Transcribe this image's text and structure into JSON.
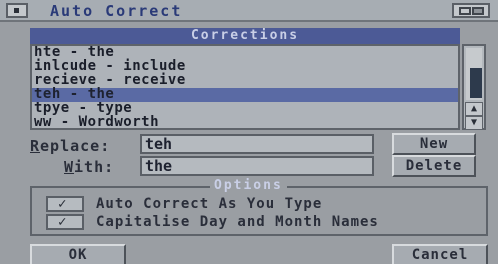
{
  "window": {
    "title": "Auto Correct"
  },
  "corrections": {
    "header": "Corrections",
    "items": [
      "hte - the",
      "inlcude - include",
      "recieve - receive",
      "teh - the",
      "tpye - type",
      "ww - Wordworth"
    ],
    "selected_index": 3
  },
  "replace": {
    "label_prefix": "R",
    "label_rest": "eplace:",
    "value": "teh"
  },
  "with": {
    "label_prefix": "W",
    "label_rest": "ith:",
    "value": "the"
  },
  "buttons": {
    "new": "New",
    "delete": "Delete",
    "ok": "OK",
    "cancel": "Cancel"
  },
  "options": {
    "title": "Options",
    "auto_correct": {
      "label": "Auto Correct As You Type",
      "checked": true
    },
    "capitalise": {
      "label": "Capitalise Day and Month Names",
      "checked": true
    }
  },
  "icons": {
    "close": "close-gadget-icon",
    "depth": "depth-gadget-icon",
    "tick": "✓"
  }
}
